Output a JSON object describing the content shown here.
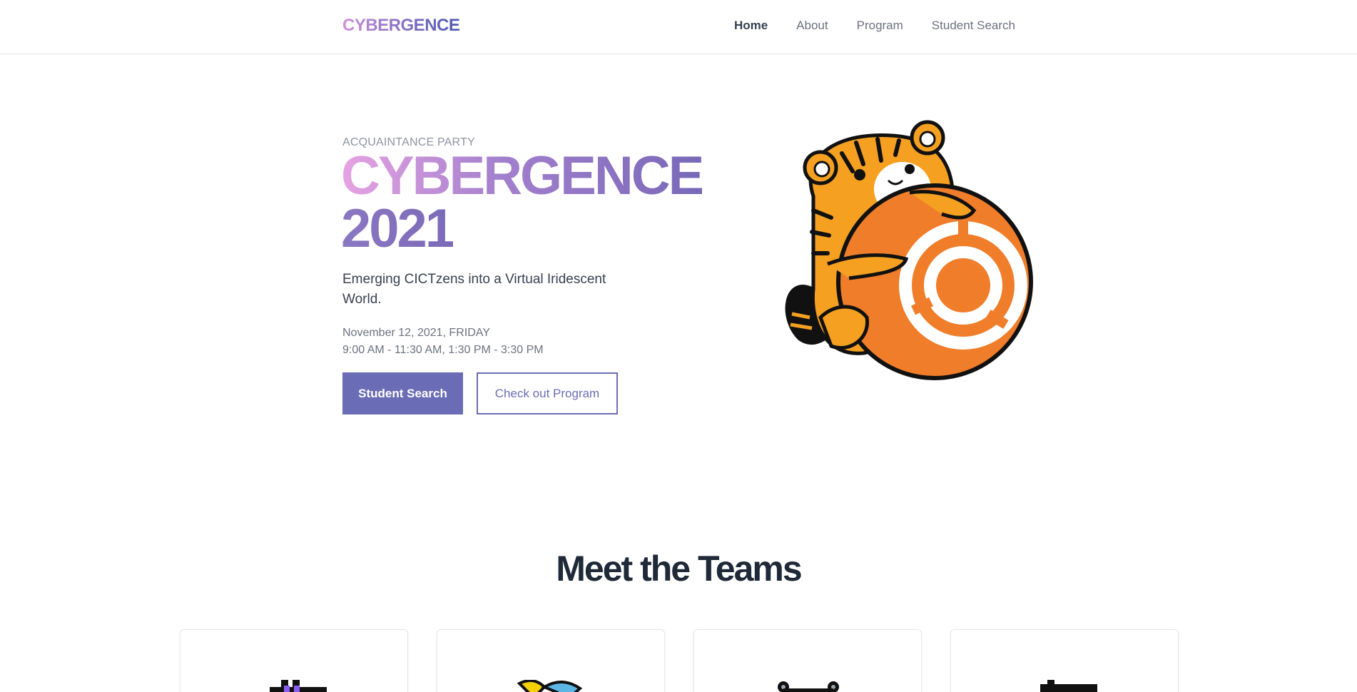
{
  "header": {
    "logo": "CYBERGENCE",
    "nav": [
      {
        "label": "Home",
        "active": true
      },
      {
        "label": "About",
        "active": false
      },
      {
        "label": "Program",
        "active": false
      },
      {
        "label": "Student Search",
        "active": false
      }
    ]
  },
  "hero": {
    "eyebrow": "ACQUAINTANCE PARTY",
    "title": "CYBERGENCE",
    "year": "2021",
    "tagline": "Emerging CICTzens into a Virtual Iridescent World.",
    "date": "November 12, 2021, FRIDAY",
    "time": "9:00 AM - 11:30 AM, 1:30 PM - 3:30 PM",
    "primary_button": "Student Search",
    "secondary_button": "Check out Program",
    "image": "tiger-mascot-with-logo"
  },
  "teams": {
    "title": "Meet the Teams",
    "cards": [
      {
        "icon": "pixel-castle-icon"
      },
      {
        "icon": "pixel-fish-icon"
      },
      {
        "icon": "pixel-controller-icon"
      },
      {
        "icon": "pixel-flag-icon"
      }
    ]
  },
  "colors": {
    "accent": "#6b6cb6",
    "gradient_start": "#e6a3e2",
    "gradient_end": "#7868b8",
    "tiger_orange": "#f5a020",
    "ball_orange": "#f07d2a"
  }
}
